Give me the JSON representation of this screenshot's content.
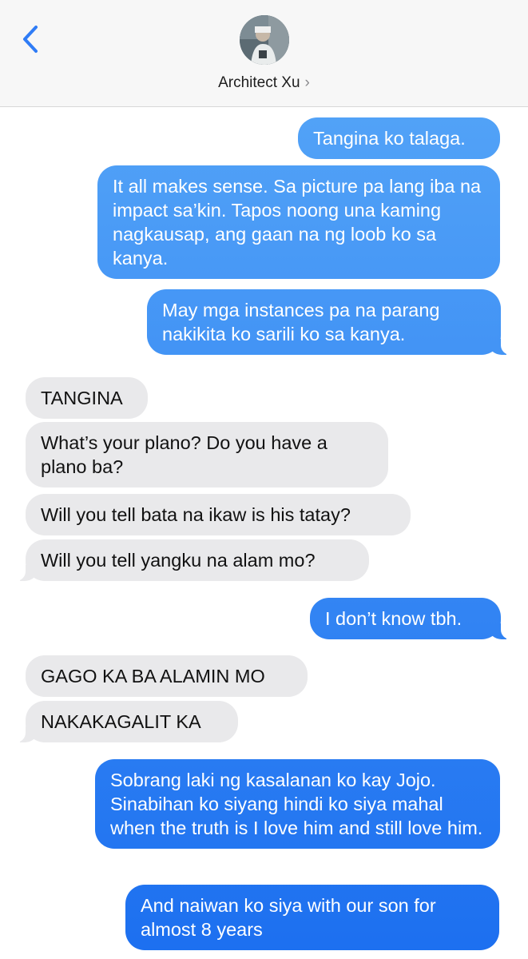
{
  "header": {
    "contact_name": "Architect Xu",
    "chevron": "›"
  },
  "colors": {
    "bubble_out_top": "#59a9f8",
    "bubble_out_bottom": "#1c6ff0",
    "bubble_in": "#e9e9eb",
    "accent": "#2f7cf6"
  },
  "icons": {
    "back": "chevron-left-icon",
    "avatar": "contact-avatar"
  },
  "messages": [
    {
      "side": "out",
      "text": "Tangina ko talaga."
    },
    {
      "side": "out",
      "text": "It all makes sense. Sa picture pa lang iba na impact sa’kin. Tapos noong una kaming nagkausap, ang gaan na ng loob ko sa kanya."
    },
    {
      "side": "out",
      "text": "May mga instances pa na parang nakikita ko sarili ko sa kanya."
    },
    {
      "side": "in",
      "text": "TANGINA"
    },
    {
      "side": "in",
      "text": "What’s your plano? Do you have a plano ba?"
    },
    {
      "side": "in",
      "text": "Will you tell bata na ikaw is his tatay?"
    },
    {
      "side": "in",
      "text": "Will you tell yangku na alam mo?"
    },
    {
      "side": "out",
      "text": "I don’t know tbh."
    },
    {
      "side": "in",
      "text": "GAGO KA BA ALAMIN MO"
    },
    {
      "side": "in",
      "text": "NAKAKAGALIT KA"
    },
    {
      "side": "out",
      "text": "Sobrang laki ng kasalanan ko kay Jojo. Sinabihan ko siyang hindi ko siya mahal when the truth is I love him and still love him."
    },
    {
      "side": "out",
      "text": "And naiwan ko siya with our son for almost 8 years"
    }
  ]
}
